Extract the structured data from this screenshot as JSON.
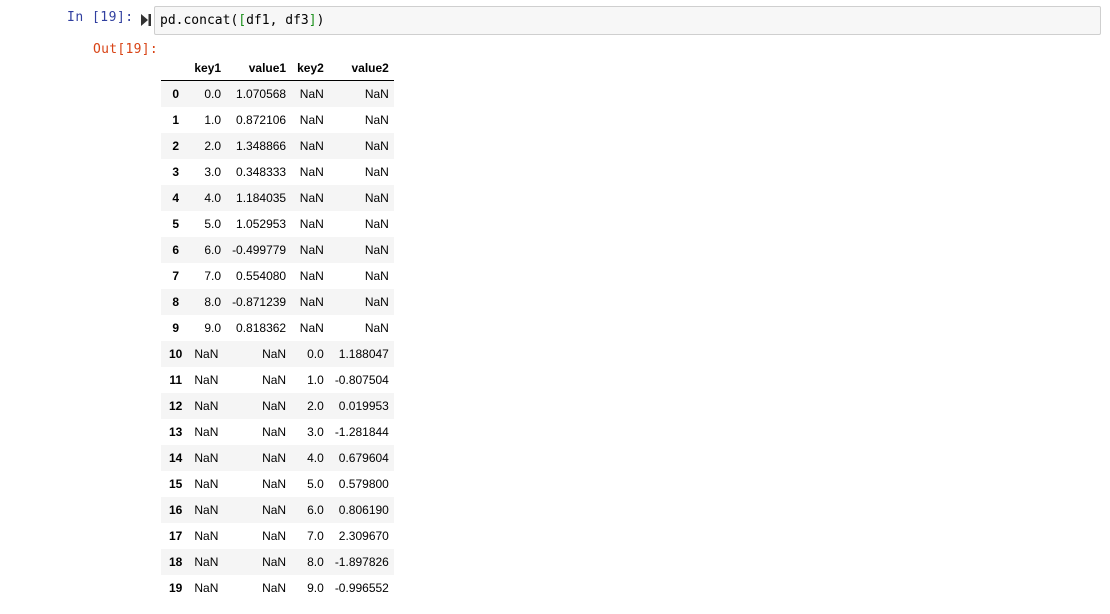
{
  "input_cell": {
    "prompt": "In [19]:",
    "code_prefix": "pd.concat(",
    "code_bracket_open": "[",
    "code_args": "df1, df3",
    "code_bracket_close": "]",
    "code_suffix": ")"
  },
  "output_cell": {
    "prompt": "Out[19]:"
  },
  "dataframe": {
    "columns": [
      "key1",
      "value1",
      "key2",
      "value2"
    ],
    "rows": [
      {
        "index": "0",
        "key1": "0.0",
        "value1": "1.070568",
        "key2": "NaN",
        "value2": "NaN"
      },
      {
        "index": "1",
        "key1": "1.0",
        "value1": "0.872106",
        "key2": "NaN",
        "value2": "NaN"
      },
      {
        "index": "2",
        "key1": "2.0",
        "value1": "1.348866",
        "key2": "NaN",
        "value2": "NaN"
      },
      {
        "index": "3",
        "key1": "3.0",
        "value1": "0.348333",
        "key2": "NaN",
        "value2": "NaN"
      },
      {
        "index": "4",
        "key1": "4.0",
        "value1": "1.184035",
        "key2": "NaN",
        "value2": "NaN"
      },
      {
        "index": "5",
        "key1": "5.0",
        "value1": "1.052953",
        "key2": "NaN",
        "value2": "NaN"
      },
      {
        "index": "6",
        "key1": "6.0",
        "value1": "-0.499779",
        "key2": "NaN",
        "value2": "NaN"
      },
      {
        "index": "7",
        "key1": "7.0",
        "value1": "0.554080",
        "key2": "NaN",
        "value2": "NaN"
      },
      {
        "index": "8",
        "key1": "8.0",
        "value1": "-0.871239",
        "key2": "NaN",
        "value2": "NaN"
      },
      {
        "index": "9",
        "key1": "9.0",
        "value1": "0.818362",
        "key2": "NaN",
        "value2": "NaN"
      },
      {
        "index": "10",
        "key1": "NaN",
        "value1": "NaN",
        "key2": "0.0",
        "value2": "1.188047"
      },
      {
        "index": "11",
        "key1": "NaN",
        "value1": "NaN",
        "key2": "1.0",
        "value2": "-0.807504"
      },
      {
        "index": "12",
        "key1": "NaN",
        "value1": "NaN",
        "key2": "2.0",
        "value2": "0.019953"
      },
      {
        "index": "13",
        "key1": "NaN",
        "value1": "NaN",
        "key2": "3.0",
        "value2": "-1.281844"
      },
      {
        "index": "14",
        "key1": "NaN",
        "value1": "NaN",
        "key2": "4.0",
        "value2": "0.679604"
      },
      {
        "index": "15",
        "key1": "NaN",
        "value1": "NaN",
        "key2": "5.0",
        "value2": "0.579800"
      },
      {
        "index": "16",
        "key1": "NaN",
        "value1": "NaN",
        "key2": "6.0",
        "value2": "0.806190"
      },
      {
        "index": "17",
        "key1": "NaN",
        "value1": "NaN",
        "key2": "7.0",
        "value2": "2.309670"
      },
      {
        "index": "18",
        "key1": "NaN",
        "value1": "NaN",
        "key2": "8.0",
        "value2": "-1.897826"
      },
      {
        "index": "19",
        "key1": "NaN",
        "value1": "NaN",
        "key2": "9.0",
        "value2": "-0.996552"
      }
    ]
  },
  "icons": {
    "run": "run-cell-icon"
  },
  "colors": {
    "in_prompt": "#303f9f",
    "out_prompt": "#d84315",
    "bracket_inner": "#1a8f1a",
    "cell_bg": "#f7f7f7",
    "cell_border": "#cfcfcf",
    "row_stripe": "#f5f5f5"
  }
}
